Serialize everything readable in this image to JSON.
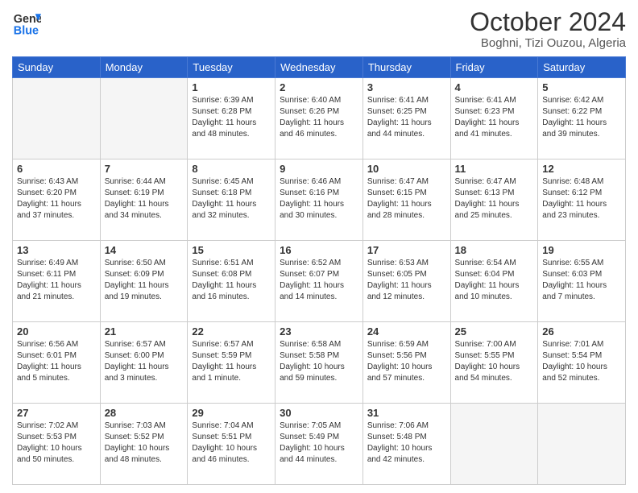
{
  "header": {
    "logo_line1": "General",
    "logo_line2": "Blue",
    "month": "October 2024",
    "location": "Boghni, Tizi Ouzou, Algeria"
  },
  "days_of_week": [
    "Sunday",
    "Monday",
    "Tuesday",
    "Wednesday",
    "Thursday",
    "Friday",
    "Saturday"
  ],
  "weeks": [
    [
      {
        "day": "",
        "empty": true
      },
      {
        "day": "",
        "empty": true
      },
      {
        "day": "1",
        "sunrise": "6:39 AM",
        "sunset": "6:28 PM",
        "daylight": "11 hours and 48 minutes."
      },
      {
        "day": "2",
        "sunrise": "6:40 AM",
        "sunset": "6:26 PM",
        "daylight": "11 hours and 46 minutes."
      },
      {
        "day": "3",
        "sunrise": "6:41 AM",
        "sunset": "6:25 PM",
        "daylight": "11 hours and 44 minutes."
      },
      {
        "day": "4",
        "sunrise": "6:41 AM",
        "sunset": "6:23 PM",
        "daylight": "11 hours and 41 minutes."
      },
      {
        "day": "5",
        "sunrise": "6:42 AM",
        "sunset": "6:22 PM",
        "daylight": "11 hours and 39 minutes."
      }
    ],
    [
      {
        "day": "6",
        "sunrise": "6:43 AM",
        "sunset": "6:20 PM",
        "daylight": "11 hours and 37 minutes."
      },
      {
        "day": "7",
        "sunrise": "6:44 AM",
        "sunset": "6:19 PM",
        "daylight": "11 hours and 34 minutes."
      },
      {
        "day": "8",
        "sunrise": "6:45 AM",
        "sunset": "6:18 PM",
        "daylight": "11 hours and 32 minutes."
      },
      {
        "day": "9",
        "sunrise": "6:46 AM",
        "sunset": "6:16 PM",
        "daylight": "11 hours and 30 minutes."
      },
      {
        "day": "10",
        "sunrise": "6:47 AM",
        "sunset": "6:15 PM",
        "daylight": "11 hours and 28 minutes."
      },
      {
        "day": "11",
        "sunrise": "6:47 AM",
        "sunset": "6:13 PM",
        "daylight": "11 hours and 25 minutes."
      },
      {
        "day": "12",
        "sunrise": "6:48 AM",
        "sunset": "6:12 PM",
        "daylight": "11 hours and 23 minutes."
      }
    ],
    [
      {
        "day": "13",
        "sunrise": "6:49 AM",
        "sunset": "6:11 PM",
        "daylight": "11 hours and 21 minutes."
      },
      {
        "day": "14",
        "sunrise": "6:50 AM",
        "sunset": "6:09 PM",
        "daylight": "11 hours and 19 minutes."
      },
      {
        "day": "15",
        "sunrise": "6:51 AM",
        "sunset": "6:08 PM",
        "daylight": "11 hours and 16 minutes."
      },
      {
        "day": "16",
        "sunrise": "6:52 AM",
        "sunset": "6:07 PM",
        "daylight": "11 hours and 14 minutes."
      },
      {
        "day": "17",
        "sunrise": "6:53 AM",
        "sunset": "6:05 PM",
        "daylight": "11 hours and 12 minutes."
      },
      {
        "day": "18",
        "sunrise": "6:54 AM",
        "sunset": "6:04 PM",
        "daylight": "11 hours and 10 minutes."
      },
      {
        "day": "19",
        "sunrise": "6:55 AM",
        "sunset": "6:03 PM",
        "daylight": "11 hours and 7 minutes."
      }
    ],
    [
      {
        "day": "20",
        "sunrise": "6:56 AM",
        "sunset": "6:01 PM",
        "daylight": "11 hours and 5 minutes."
      },
      {
        "day": "21",
        "sunrise": "6:57 AM",
        "sunset": "6:00 PM",
        "daylight": "11 hours and 3 minutes."
      },
      {
        "day": "22",
        "sunrise": "6:57 AM",
        "sunset": "5:59 PM",
        "daylight": "11 hours and 1 minute."
      },
      {
        "day": "23",
        "sunrise": "6:58 AM",
        "sunset": "5:58 PM",
        "daylight": "10 hours and 59 minutes."
      },
      {
        "day": "24",
        "sunrise": "6:59 AM",
        "sunset": "5:56 PM",
        "daylight": "10 hours and 57 minutes."
      },
      {
        "day": "25",
        "sunrise": "7:00 AM",
        "sunset": "5:55 PM",
        "daylight": "10 hours and 54 minutes."
      },
      {
        "day": "26",
        "sunrise": "7:01 AM",
        "sunset": "5:54 PM",
        "daylight": "10 hours and 52 minutes."
      }
    ],
    [
      {
        "day": "27",
        "sunrise": "7:02 AM",
        "sunset": "5:53 PM",
        "daylight": "10 hours and 50 minutes."
      },
      {
        "day": "28",
        "sunrise": "7:03 AM",
        "sunset": "5:52 PM",
        "daylight": "10 hours and 48 minutes."
      },
      {
        "day": "29",
        "sunrise": "7:04 AM",
        "sunset": "5:51 PM",
        "daylight": "10 hours and 46 minutes."
      },
      {
        "day": "30",
        "sunrise": "7:05 AM",
        "sunset": "5:49 PM",
        "daylight": "10 hours and 44 minutes."
      },
      {
        "day": "31",
        "sunrise": "7:06 AM",
        "sunset": "5:48 PM",
        "daylight": "10 hours and 42 minutes."
      },
      {
        "day": "",
        "empty": true
      },
      {
        "day": "",
        "empty": true
      }
    ]
  ]
}
